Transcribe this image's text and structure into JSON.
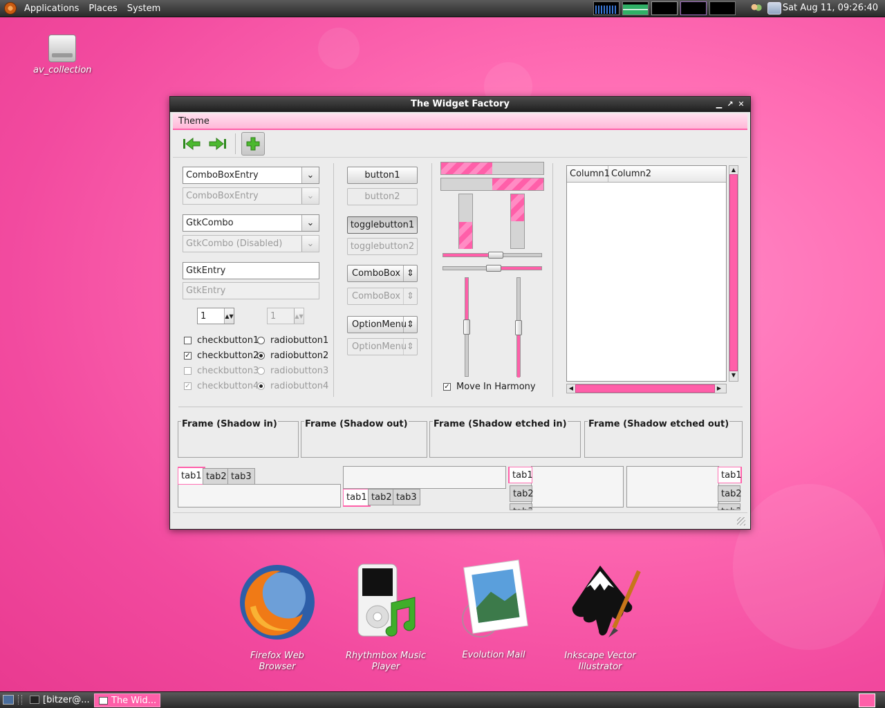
{
  "top_panel": {
    "menus": [
      "Applications",
      "Places",
      "System"
    ],
    "clock": "Sat Aug 11, 09:26:40"
  },
  "desktop": {
    "drive_label": "av_collection"
  },
  "window": {
    "title": "The Widget Factory",
    "menu": "Theme",
    "combos": {
      "entry1": "ComboBoxEntry",
      "entry2": "ComboBoxEntry",
      "gtkcombo": "GtkCombo",
      "gtkcombo_disabled": "GtkCombo (Disabled)",
      "gtkentry": "GtkEntry",
      "gtkentry_disabled": "GtkEntry",
      "spin1": "1",
      "spin2": "1"
    },
    "checks": [
      "checkbutton1",
      "checkbutton2",
      "checkbutton3",
      "checkbutton4"
    ],
    "radios": [
      "radiobutton1",
      "radiobutton2",
      "radiobutton3",
      "radiobutton4"
    ],
    "buttons": {
      "button1": "button1",
      "button2": "button2",
      "toggle1": "togglebutton1",
      "toggle2": "togglebutton2",
      "combobox1": "ComboBox",
      "combobox2": "ComboBox",
      "option1": "OptionMenu",
      "option2": "OptionMenu"
    },
    "progress": {
      "h1": 0.5,
      "h2": 0.5,
      "v1": 0.5,
      "v2": 0.5
    },
    "harmony": "Move In Harmony",
    "tree": {
      "col1": "Column1",
      "col2": "Column2"
    },
    "frames": [
      "Frame (Shadow in)",
      "Frame (Shadow out)",
      "Frame (Shadow etched in)",
      "Frame (Shadow etched out)"
    ],
    "tabs": [
      "tab1",
      "tab2",
      "tab3"
    ]
  },
  "launchers": [
    {
      "label": "Firefox Web Browser"
    },
    {
      "label": "Rhythmbox Music Player"
    },
    {
      "label": "Evolution Mail"
    },
    {
      "label": "Inkscape Vector Illustrator"
    }
  ],
  "taskbar": {
    "tasks": [
      "[bitzer@...",
      "The Wid..."
    ]
  },
  "colors": {
    "accent": "#ff5fa9",
    "panel": "#3a3a3a"
  }
}
